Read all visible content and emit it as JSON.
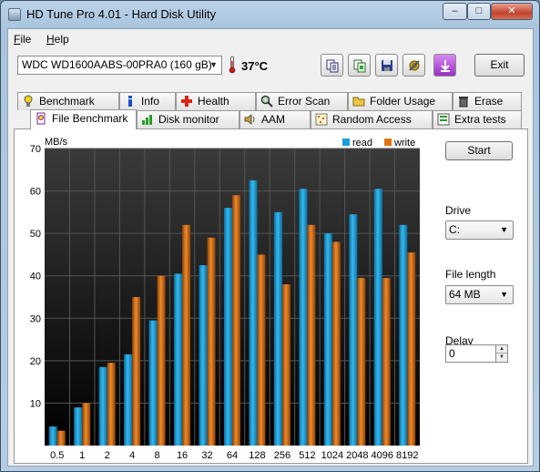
{
  "window": {
    "title": "HD Tune Pro 4.01 - Hard Disk Utility",
    "min_glyph": "–",
    "max_glyph": "□",
    "close_glyph": "✕"
  },
  "menu": [
    {
      "label": "File"
    },
    {
      "label": "Help"
    }
  ],
  "toolbar": {
    "drive": "WDC WD1600AABS-00PRA0 (160 gB)",
    "temperature": "37°C",
    "exit_label": "Exit",
    "icons": [
      "copy-text-icon",
      "copy-screenshot-icon",
      "save-icon",
      "options-icon",
      "download-icon"
    ]
  },
  "tabs_top": [
    {
      "label": "Benchmark",
      "icon": "benchmark-icon"
    },
    {
      "label": "Info",
      "icon": "info-icon"
    },
    {
      "label": "Health",
      "icon": "health-icon"
    },
    {
      "label": "Error Scan",
      "icon": "error-scan-icon"
    },
    {
      "label": "Folder Usage",
      "icon": "folder-icon"
    },
    {
      "label": "Erase",
      "icon": "erase-icon"
    }
  ],
  "tabs_bottom": [
    {
      "label": "File Benchmark",
      "icon": "file-benchmark-icon",
      "active": true
    },
    {
      "label": "Disk monitor",
      "icon": "disk-monitor-icon"
    },
    {
      "label": "AAM",
      "icon": "speaker-icon"
    },
    {
      "label": "Random Access",
      "icon": "random-access-icon"
    },
    {
      "label": "Extra tests",
      "icon": "extra-tests-icon"
    }
  ],
  "side": {
    "start_label": "Start",
    "drive_label": "Drive",
    "drive_value": "C:",
    "file_length_label": "File length",
    "file_length_value": "64 MB",
    "delay_label": "Delay",
    "delay_value": "0"
  },
  "chart_data": {
    "type": "bar",
    "ylabel": "MB/s",
    "ylim": [
      0,
      70
    ],
    "yticks": [
      10,
      20,
      30,
      40,
      50,
      60,
      70
    ],
    "categories": [
      "0.5",
      "1",
      "2",
      "4",
      "8",
      "16",
      "32",
      "64",
      "128",
      "256",
      "512",
      "1024",
      "2048",
      "4096",
      "8192"
    ],
    "series": [
      {
        "name": "read",
        "color": "#1c9fd8",
        "values": [
          4.5,
          9,
          18.5,
          21.5,
          29.5,
          40.5,
          42.5,
          56,
          62.5,
          55,
          60.5,
          50,
          54.5,
          60.5,
          52
        ]
      },
      {
        "name": "write",
        "color": "#e07414",
        "values": [
          3.5,
          10,
          19.5,
          35,
          40,
          52,
          49,
          59,
          45,
          38,
          52,
          48,
          39.5,
          39.5,
          45.5
        ]
      }
    ],
    "legend_position": "top-right",
    "grid": true
  }
}
